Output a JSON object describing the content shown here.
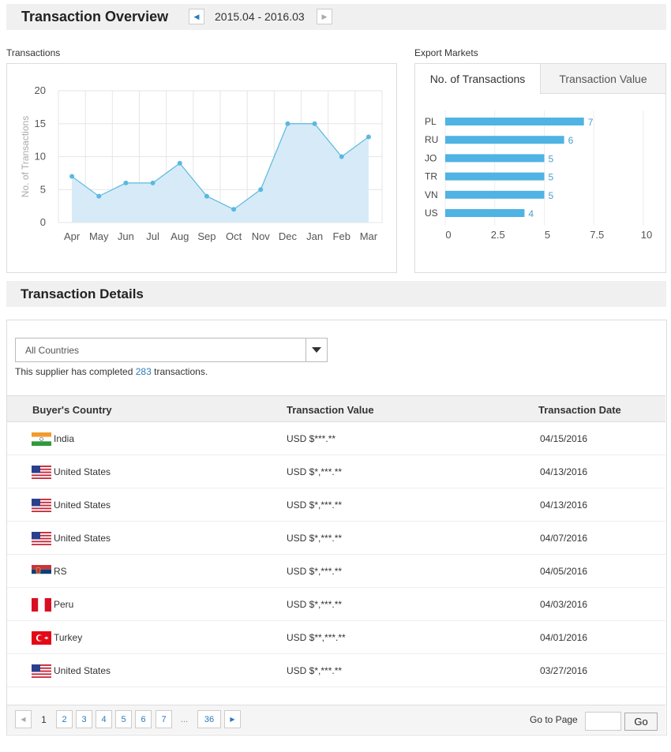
{
  "header": {
    "title": "Transaction Overview",
    "date_range": "2015.04 - 2016.03",
    "prev_icon": "triangle-left-icon",
    "next_icon": "triangle-right-icon"
  },
  "transactions_panel": {
    "label": "Transactions"
  },
  "export_panel": {
    "label": "Export Markets",
    "tabs": [
      {
        "label": "No. of Transactions",
        "active": true
      },
      {
        "label": "Transaction Value",
        "active": false
      }
    ]
  },
  "chart_data": [
    {
      "type": "area",
      "title": "Transactions",
      "ylabel": "No. of Transactions",
      "xlabel": "",
      "categories": [
        "Apr",
        "May",
        "Jun",
        "Jul",
        "Aug",
        "Sep",
        "Oct",
        "Nov",
        "Dec",
        "Jan",
        "Feb",
        "Mar"
      ],
      "values": [
        7,
        4,
        6,
        6,
        9,
        4,
        2,
        5,
        15,
        15,
        10,
        13
      ],
      "ylim": [
        0,
        20
      ],
      "yticks": [
        "0",
        "5",
        "10",
        "15",
        "20"
      ],
      "grid": true,
      "color": "#5bb8e0",
      "fill": "#d6ebf7"
    },
    {
      "type": "bar",
      "orientation": "horizontal",
      "title": "Export Markets",
      "categories": [
        "PL",
        "RU",
        "JO",
        "TR",
        "VN",
        "US"
      ],
      "values": [
        7,
        6,
        5,
        5,
        5,
        4
      ],
      "xlim": [
        0,
        10
      ],
      "xticks": [
        "0",
        "2.5",
        "5",
        "7.5",
        "10"
      ],
      "grid": true,
      "color": "#4fb3e3"
    }
  ],
  "details": {
    "title": "Transaction Details",
    "filter": {
      "selected": "All Countries",
      "arrow_icon": "caret-down-icon"
    },
    "summary_prefix": "This supplier has completed ",
    "summary_count": "283",
    "summary_suffix": " transactions.",
    "columns": [
      "Buyer's Country",
      "Transaction Value",
      "Transaction Date"
    ],
    "rows": [
      {
        "flag": "india-flag-icon",
        "country": "India",
        "value": "USD $***.**",
        "date": "04/15/2016"
      },
      {
        "flag": "us-flag-icon",
        "country": "United States",
        "value": "USD $*,***.**",
        "date": "04/13/2016"
      },
      {
        "flag": "us-flag-icon",
        "country": "United States",
        "value": "USD $*,***.**",
        "date": "04/13/2016"
      },
      {
        "flag": "us-flag-icon",
        "country": "United States",
        "value": "USD $*,***.**",
        "date": "04/07/2016"
      },
      {
        "flag": "serbia-flag-icon",
        "country": "RS",
        "value": "USD $*,***.**",
        "date": "04/05/2016"
      },
      {
        "flag": "peru-flag-icon",
        "country": "Peru",
        "value": "USD $*,***.**",
        "date": "04/03/2016"
      },
      {
        "flag": "turkey-flag-icon",
        "country": "Turkey",
        "value": "USD $**,***.**",
        "date": "04/01/2016"
      },
      {
        "flag": "us-flag-icon",
        "country": "United States",
        "value": "USD $*,***.**",
        "date": "03/27/2016"
      }
    ]
  },
  "pagination": {
    "current": "1",
    "pages": [
      "2",
      "3",
      "4",
      "5",
      "6",
      "7"
    ],
    "ellipsis": "...",
    "last": "36",
    "goto_label": "Go to Page",
    "goto_value": "",
    "go_button": "Go"
  }
}
